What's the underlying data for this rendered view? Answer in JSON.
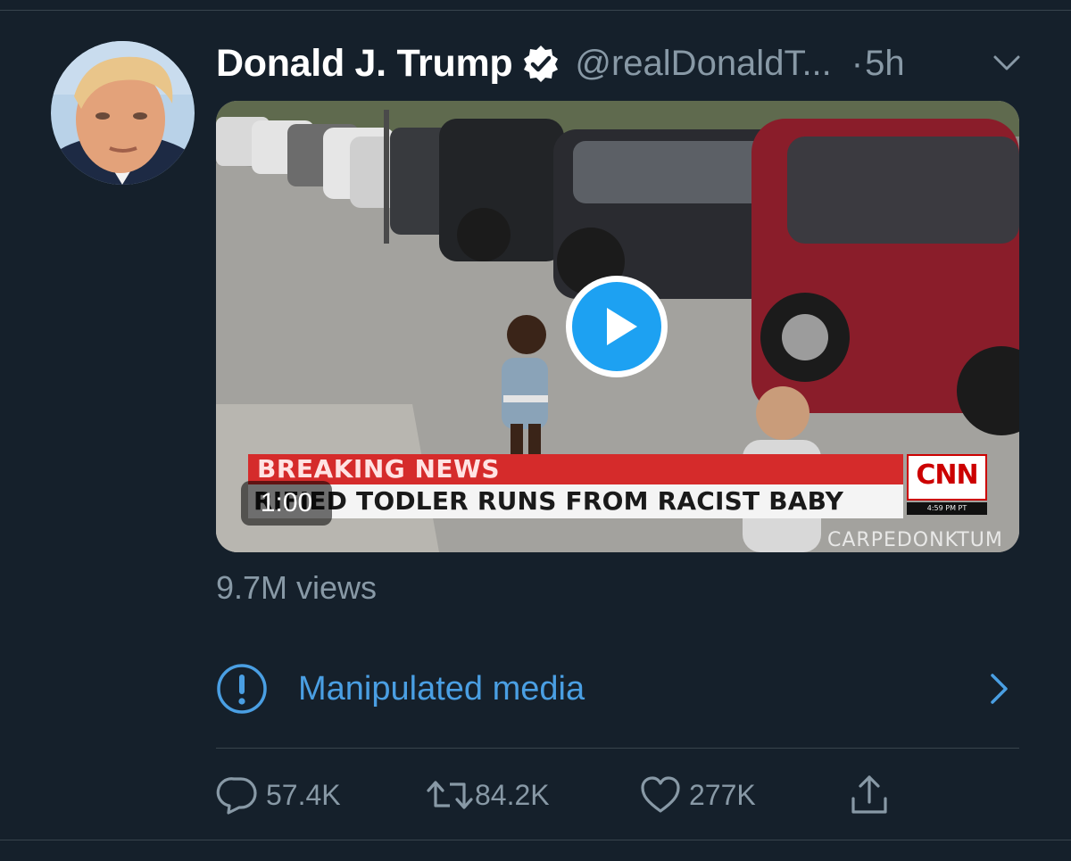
{
  "tweet": {
    "author": {
      "display_name": "Donald J. Trump",
      "handle": "@realDonaldT...",
      "verified": true
    },
    "separator": "·",
    "time": "5h",
    "menu_icon": "chevron-down-icon"
  },
  "video": {
    "duration": "1:00",
    "banner_top": "BREAKING NEWS",
    "banner_bottom": "RIFIED TODLER RUNS FROM RACIST BABY",
    "channel_logo": "CNN",
    "channel_time": "4:59 PM PT",
    "watermark": "CARPEDONKTUM",
    "play_icon": "play-icon"
  },
  "views": "9.7M views",
  "notice": {
    "label": "Manipulated media",
    "icon": "exclamation-circle-icon",
    "chevron_icon": "chevron-right-icon"
  },
  "actions": {
    "reply": {
      "icon": "reply-icon",
      "count": "57.4K"
    },
    "retweet": {
      "icon": "retweet-icon",
      "count": "84.2K"
    },
    "like": {
      "icon": "heart-icon",
      "count": "277K"
    },
    "share": {
      "icon": "share-icon"
    }
  },
  "colors": {
    "background": "#15202b",
    "accent": "#1da1f2",
    "link": "#4a9fe3",
    "muted": "#8899a6",
    "divider": "#38444d"
  }
}
